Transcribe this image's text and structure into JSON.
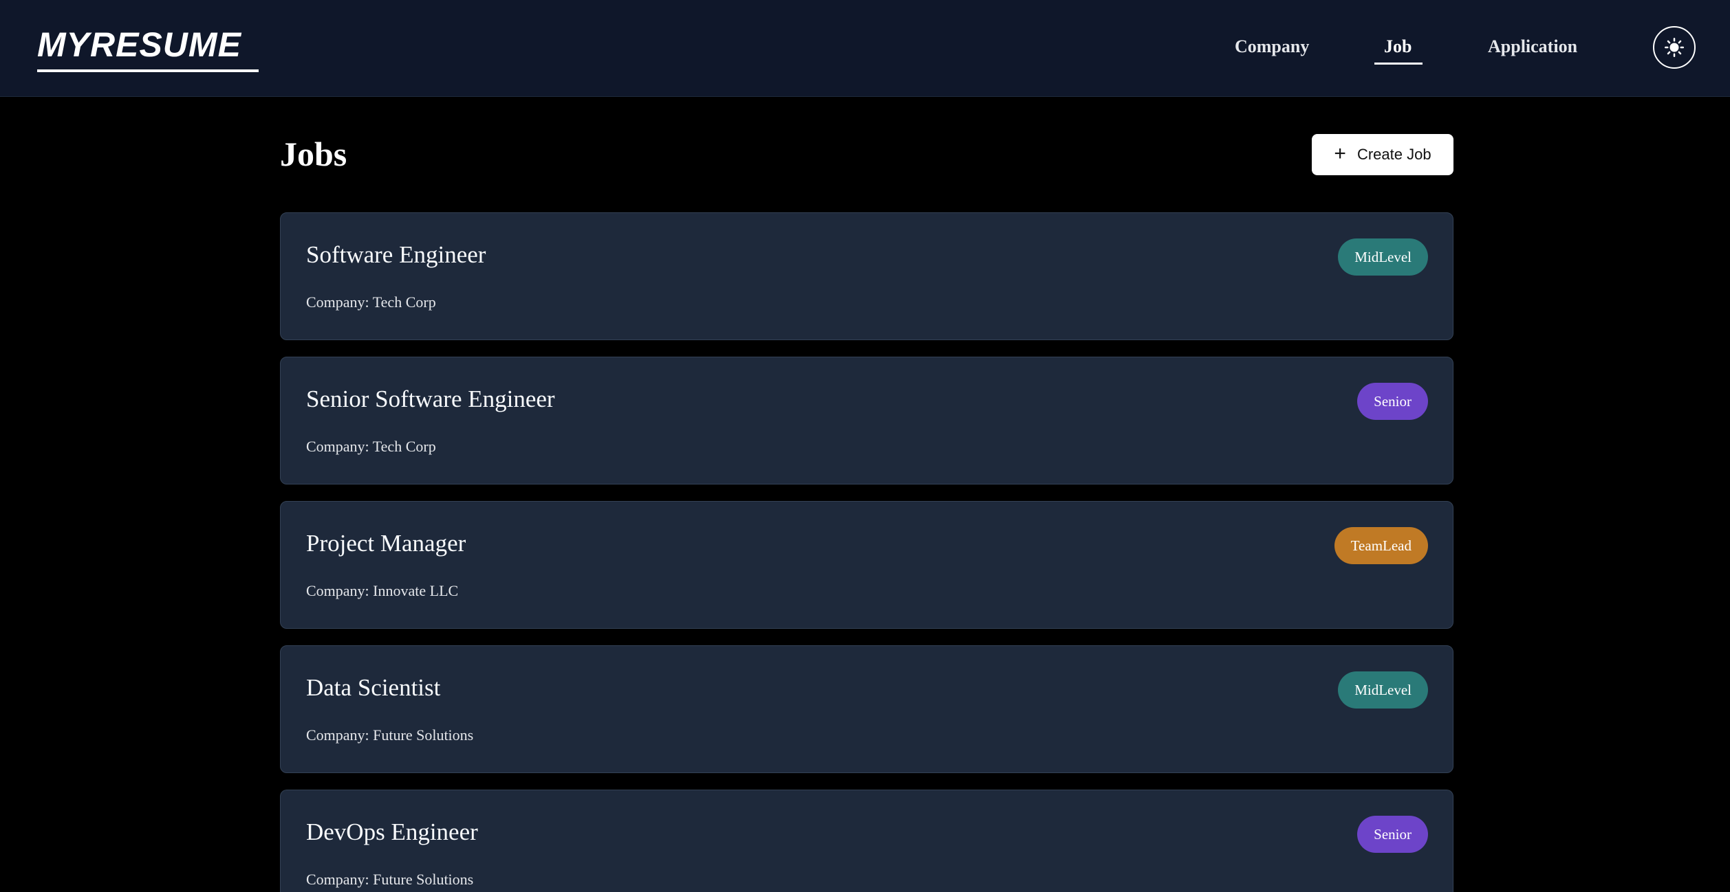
{
  "header": {
    "logo": "MYRESUME",
    "nav": [
      {
        "label": "Company",
        "active": false
      },
      {
        "label": "Job",
        "active": true
      },
      {
        "label": "Application",
        "active": false
      }
    ],
    "theme_toggle_icon": "sun-icon"
  },
  "main": {
    "title": "Jobs",
    "create_button": {
      "label": "Create Job",
      "icon": "plus-icon"
    },
    "jobs": [
      {
        "title": "Software Engineer",
        "company": "Company: Tech Corp",
        "level": "MidLevel",
        "level_color": "#2a7a78"
      },
      {
        "title": "Senior Software Engineer",
        "company": "Company: Tech Corp",
        "level": "Senior",
        "level_color": "#6d44c9"
      },
      {
        "title": "Project Manager",
        "company": "Company: Innovate LLC",
        "level": "TeamLead",
        "level_color": "#c07a25"
      },
      {
        "title": "Data Scientist",
        "company": "Company: Future Solutions",
        "level": "MidLevel",
        "level_color": "#2a7a78"
      },
      {
        "title": "DevOps Engineer",
        "company": "Company: Future Solutions",
        "level": "Senior",
        "level_color": "#6d44c9"
      }
    ]
  },
  "colors": {
    "page_bg": "#000000",
    "header_bg": "#0f172a",
    "card_bg": "#1e293b",
    "card_border": "#334155",
    "midlevel": "#2a7a78",
    "senior": "#6d44c9",
    "teamlead": "#c07a25"
  }
}
